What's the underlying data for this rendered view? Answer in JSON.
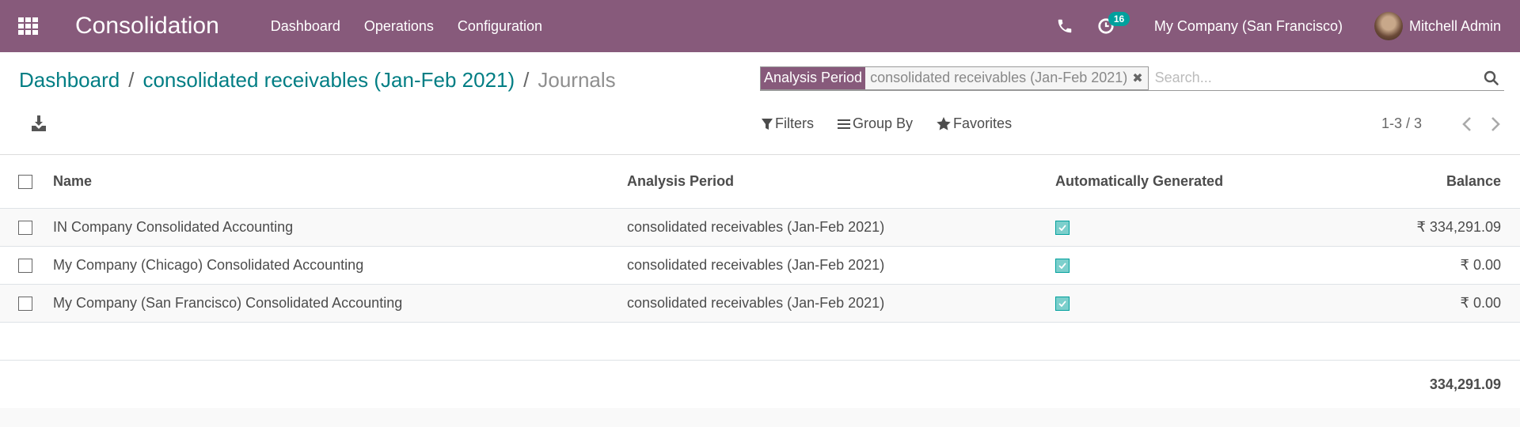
{
  "navbar": {
    "app_title": "Consolidation",
    "menu": [
      {
        "label": "Dashboard"
      },
      {
        "label": "Operations"
      },
      {
        "label": "Configuration"
      }
    ],
    "activity_count": "16",
    "company": "My Company (San Francisco)",
    "user": "Mitchell Admin",
    "brand_color": "#875a7b"
  },
  "breadcrumb": {
    "items": [
      {
        "label": "Dashboard"
      },
      {
        "label": "consolidated receivables (Jan-Feb 2021)"
      }
    ],
    "separator": "/",
    "current": "Journals"
  },
  "search": {
    "facet_label": "Analysis Period",
    "facet_value": "consolidated receivables (Jan-Feb 2021)",
    "placeholder": "Search...",
    "value": ""
  },
  "filters": {
    "filters_label": "Filters",
    "group_by_label": "Group By",
    "favorites_label": "Favorites"
  },
  "pager": {
    "value": "1-3 / 3"
  },
  "table": {
    "columns": {
      "name": "Name",
      "period": "Analysis Period",
      "auto": "Automatically Generated",
      "balance": "Balance"
    },
    "rows": [
      {
        "name": "IN Company Consolidated Accounting",
        "period": "consolidated receivables (Jan-Feb 2021)",
        "auto": true,
        "balance": "₹ 334,291.09"
      },
      {
        "name": "My Company (Chicago) Consolidated Accounting",
        "period": "consolidated receivables (Jan-Feb 2021)",
        "auto": true,
        "balance": "₹ 0.00"
      },
      {
        "name": "My Company (San Francisco) Consolidated Accounting",
        "period": "consolidated receivables (Jan-Feb 2021)",
        "auto": true,
        "balance": "₹ 0.00"
      }
    ],
    "total_balance": "334,291.09"
  }
}
